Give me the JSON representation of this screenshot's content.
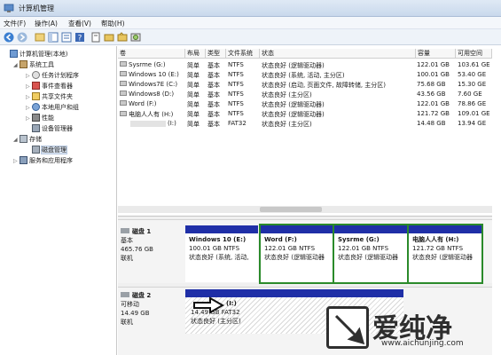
{
  "window": {
    "title": "计算机管理",
    "icon": "computer-management-icon"
  },
  "menu": [
    "文件(F)",
    "操作(A)",
    "查看(V)",
    "帮助(H)"
  ],
  "toolbar": {
    "icons": [
      "back-icon",
      "forward-icon",
      "up-icon",
      "show-hide-tree-icon",
      "properties-icon",
      "help-icon",
      "refresh-icon",
      "export-icon",
      "open-icon",
      "cd-icon"
    ]
  },
  "tree": {
    "root": "计算机管理(本地)",
    "system_tools": "系统工具",
    "task_scheduler": "任务计划程序",
    "event_viewer": "事件查看器",
    "shared_folders": "共享文件夹",
    "local_users": "本地用户和组",
    "performance": "性能",
    "device_manager": "设备管理器",
    "storage": "存储",
    "disk_management": "磁盘管理",
    "services": "服务和应用程序"
  },
  "volume_table": {
    "headers": [
      "卷",
      "布局",
      "类型",
      "文件系统",
      "状态",
      "容量",
      "可用空间"
    ],
    "rows": [
      {
        "volume": "Sysrme (G:)",
        "layout": "简单",
        "type": "基本",
        "fs": "NTFS",
        "status": "状态良好 (逻辑驱动器)",
        "capacity": "122.01 GB",
        "free": "103.61 GE"
      },
      {
        "volume": "Windows 10 (E:)",
        "layout": "简单",
        "type": "基本",
        "fs": "NTFS",
        "status": "状态良好 (系统, 活动, 主分区)",
        "capacity": "100.01 GB",
        "free": "53.40 GE"
      },
      {
        "volume": "Windows7E (C:)",
        "layout": "简单",
        "type": "基本",
        "fs": "NTFS",
        "status": "状态良好 (启动, 页面文件, 故障转储, 主分区)",
        "capacity": "75.68 GB",
        "free": "15.30 GE"
      },
      {
        "volume": "Windows8 (D:)",
        "layout": "简单",
        "type": "基本",
        "fs": "NTFS",
        "status": "状态良好 (主分区)",
        "capacity": "43.56 GB",
        "free": "7.60 GE"
      },
      {
        "volume": "Word (F:)",
        "layout": "简单",
        "type": "基本",
        "fs": "NTFS",
        "status": "状态良好 (逻辑驱动器)",
        "capacity": "122.01 GB",
        "free": "78.86 GE"
      },
      {
        "volume": "电脑人人有 (H:)",
        "layout": "简单",
        "type": "基本",
        "fs": "NTFS",
        "status": "状态良好 (逻辑驱动器)",
        "capacity": "121.72 GB",
        "free": "109.01 GE"
      },
      {
        "volume": "(I:)",
        "layout": "简单",
        "type": "基本",
        "fs": "FAT32",
        "status": "状态良好 (主分区)",
        "capacity": "14.48 GB",
        "free": "13.94 GE"
      }
    ]
  },
  "disk1": {
    "name": "磁盘 1",
    "type": "基本",
    "size": "465.76 GB",
    "status": "联机",
    "partitions": [
      {
        "title": "Windows 10  (E:)",
        "info": "100.01 GB NTFS",
        "status": "状态良好 (系统, 活动,"
      },
      {
        "title": "Word  (F:)",
        "info": "122.01 GB NTFS",
        "status": "状态良好 (逻辑驱动器"
      },
      {
        "title": "Sysrme  (G:)",
        "info": "122.01 GB NTFS",
        "status": "状态良好 (逻辑驱动器"
      },
      {
        "title": "电脑人人有  (H:)",
        "info": "121.72 GB NTFS",
        "status": "状态良好 (逻辑驱动器"
      }
    ]
  },
  "disk2": {
    "name": "磁盘 2",
    "type": "可移动",
    "size": "14.49 GB",
    "status": "联机",
    "partition": {
      "title": "(I:)",
      "info": "14.49 GB FAT32",
      "status": "状态良好 (主分区)"
    }
  },
  "watermark": {
    "brand": "爱纯净",
    "url": "www.aichunjing.com"
  }
}
